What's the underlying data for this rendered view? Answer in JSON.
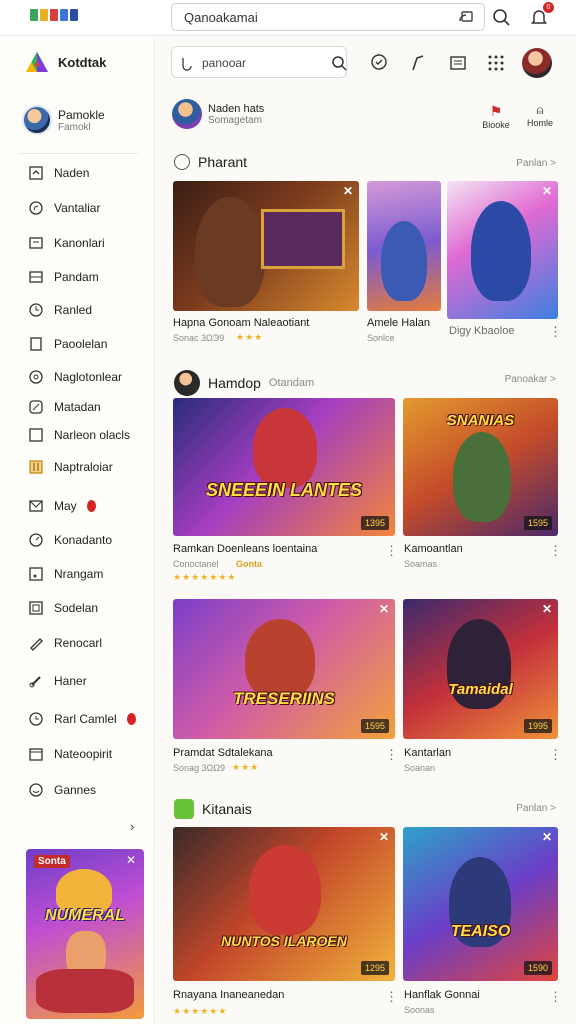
{
  "topbar": {
    "search_value": "Qanoakamai",
    "notification_count": "0"
  },
  "sidebar": {
    "app_name": "Kotdtak",
    "profile": {
      "name": "Pamokle",
      "sub": "Famokl"
    },
    "items": [
      {
        "label": "Naden",
        "icon": "home-icon"
      },
      {
        "label": "Vantaliar",
        "icon": "compass-icon"
      },
      {
        "label": "Kanonlari",
        "icon": "library-icon"
      },
      {
        "label": "Pandam",
        "icon": "film-icon"
      },
      {
        "label": "Ranled",
        "icon": "clock-icon"
      },
      {
        "label": "Paoolelan",
        "icon": "document-icon"
      },
      {
        "label": "Naglotonlear",
        "icon": "settings-icon"
      },
      {
        "label": "Matadan",
        "icon": "percent-icon"
      },
      {
        "label": "Narleon olacls",
        "icon": "square-icon"
      },
      {
        "label": "Naptraloiar",
        "icon": "grid-icon"
      },
      {
        "label": "May",
        "icon": "mail-icon"
      },
      {
        "label": "Konadanto",
        "icon": "gauge-icon"
      },
      {
        "label": "Nrangam",
        "icon": "music-icon"
      },
      {
        "label": "Sodelan",
        "icon": "frame-icon"
      },
      {
        "label": "Renocarl",
        "icon": "brush-icon"
      },
      {
        "label": "Haner",
        "icon": "link-icon"
      },
      {
        "label": "Rarl Camlel",
        "icon": "replay-icon"
      },
      {
        "label": "Nateoopirit",
        "icon": "calendar-icon"
      },
      {
        "label": "Gannes",
        "icon": "gamepad-icon"
      }
    ],
    "promo": {
      "tag": "Sonta",
      "wordmark": "NUMERAL"
    }
  },
  "main": {
    "search_value": "panooar",
    "channel": {
      "name": "Naden hats",
      "sub": "Somagetam",
      "action1": "Biooke",
      "action2": "Homle"
    },
    "sections": [
      {
        "title": "Pharant",
        "more": "Panlan >",
        "cards": [
          {
            "title": "Hapna Gonoam Naleaotiant",
            "meta": "Sonac 3ΩЭ9",
            "stars": "★★★",
            "badge": "",
            "wordmark": ""
          },
          {
            "title": "Amele Halan",
            "meta": "Sonlce",
            "stars": "",
            "badge": "",
            "wordmark": ""
          },
          {
            "title": "Digy Kbaoloe",
            "meta": "",
            "stars": "",
            "badge": "",
            "wordmark": ""
          }
        ]
      },
      {
        "title": "Hamdop",
        "subtitle": "Otandam",
        "more": "Panoakar >",
        "cards": [
          {
            "title": "Ramkan Doenleans loentaina",
            "meta": "Conoctanel",
            "meta_accent": "Gonta",
            "stars": "★★★★★★★",
            "badge": "1395",
            "wordmark": "SNEEEIN LANTES"
          },
          {
            "title": "Kamoantlan",
            "meta": "Soamas",
            "stars": "",
            "badge": "1595",
            "wordmark": "SNANIAS"
          },
          {
            "title": "Pramdat Sdtalekana",
            "meta": "Sonag 3ΩΩ9",
            "stars": "★★★",
            "badge": "1595",
            "wordmark": "TRESERIINS"
          },
          {
            "title": "Kantarlan",
            "meta": "Soanan",
            "stars": "",
            "badge": "1995",
            "wordmark": "Tamaidal"
          }
        ]
      },
      {
        "title": "Kitanais",
        "more": "Panlan >",
        "cards": [
          {
            "title": "Rnayana Inaneanedan",
            "meta": "",
            "stars": "★★★★★★",
            "badge": "1295",
            "wordmark": "NUNTOS ILAROEN"
          },
          {
            "title": "Hanflak Gonnai",
            "meta": "Soonas",
            "stars": "",
            "badge": "1590",
            "wordmark": "TEAISO"
          }
        ]
      }
    ]
  },
  "colors": {
    "accent": "#d62424",
    "star": "#f0b323",
    "wordmark": "#ffde47"
  }
}
